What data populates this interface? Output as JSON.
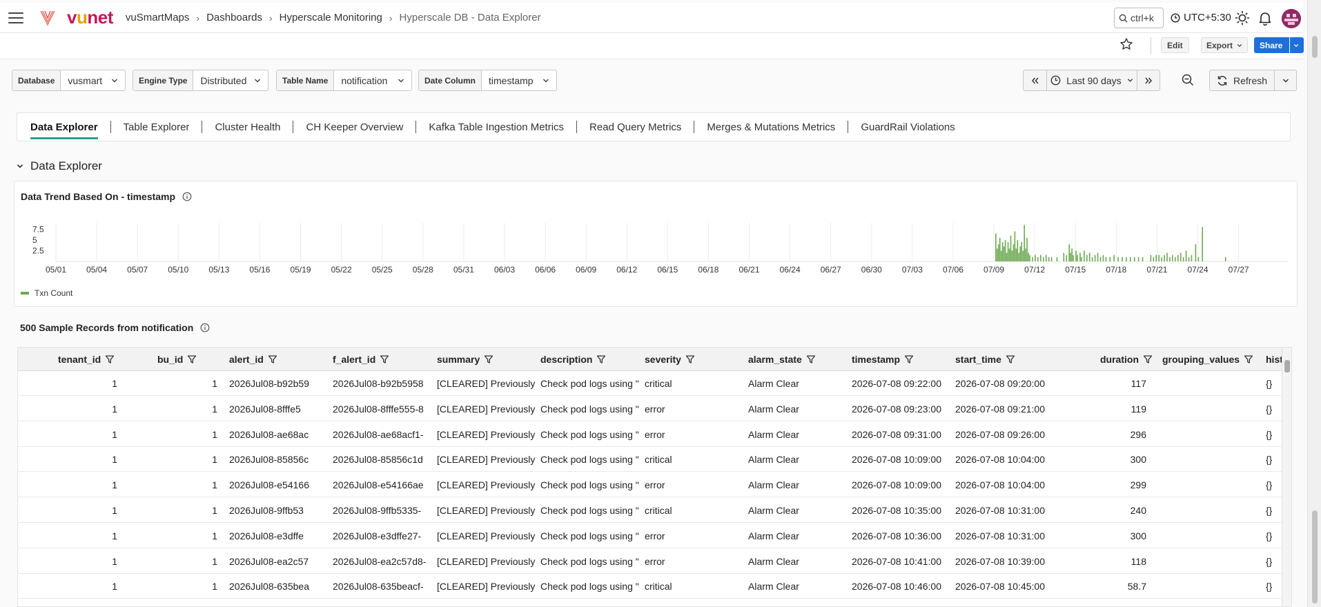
{
  "header": {
    "logo_text": "vunet",
    "breadcrumbs": [
      "vuSmartMaps",
      "Dashboards",
      "Hyperscale Monitoring",
      "Hyperscale DB - Data Explorer"
    ],
    "search_placeholder": "ctrl+k",
    "timezone": "UTC+5:30"
  },
  "actions": {
    "edit_label": "Edit",
    "export_label": "Export",
    "share_label": "Share"
  },
  "filters": [
    {
      "label": "Database",
      "value": "vusmart"
    },
    {
      "label": "Engine Type",
      "value": "Distributed"
    },
    {
      "label": "Table Name",
      "value": "notification"
    },
    {
      "label": "Date Column",
      "value": "timestamp"
    }
  ],
  "time_range": "Last 90 days",
  "refresh_label": "Refresh",
  "tabs": [
    {
      "label": "Data Explorer",
      "active": true
    },
    {
      "label": "Table Explorer",
      "active": false
    },
    {
      "label": "Cluster Health",
      "active": false
    },
    {
      "label": "CH Keeper Overview",
      "active": false
    },
    {
      "label": "Kafka Table Ingestion Metrics",
      "active": false
    },
    {
      "label": "Read Query Metrics",
      "active": false
    },
    {
      "label": "Merges & Mutations Metrics",
      "active": false
    },
    {
      "label": "GuardRail Violations",
      "active": false
    }
  ],
  "section_title": "Data Explorer",
  "chart_panel_title": "Data Trend Based On - timestamp",
  "chart_data": {
    "type": "bar",
    "series": [
      {
        "name": "Txn Count",
        "color": "#6aa84f"
      }
    ],
    "ylim": [
      0,
      9
    ],
    "y_ticks": [
      "2.5",
      "5",
      "7.5"
    ],
    "x_ticks": [
      "05/01",
      "05/04",
      "05/07",
      "05/10",
      "05/13",
      "05/16",
      "05/19",
      "05/22",
      "05/25",
      "05/28",
      "05/31",
      "06/03",
      "06/06",
      "06/09",
      "06/12",
      "06/15",
      "06/18",
      "06/21",
      "06/24",
      "06/27",
      "06/30",
      "07/03",
      "07/06",
      "07/09",
      "07/12",
      "07/15",
      "07/18",
      "07/21",
      "07/24",
      "07/27"
    ],
    "x_range_days": [
      0,
      89
    ],
    "bars": [
      [
        69.1,
        6.5
      ],
      [
        69.2,
        3
      ],
      [
        69.3,
        4
      ],
      [
        69.4,
        5.5
      ],
      [
        69.5,
        2.5
      ],
      [
        69.6,
        4.5
      ],
      [
        69.7,
        3.5
      ],
      [
        69.8,
        5
      ],
      [
        69.9,
        2
      ],
      [
        70.0,
        4.5
      ],
      [
        70.1,
        3
      ],
      [
        70.2,
        6
      ],
      [
        70.3,
        2.5
      ],
      [
        70.4,
        4
      ],
      [
        70.5,
        7
      ],
      [
        70.6,
        3
      ],
      [
        70.7,
        5
      ],
      [
        70.8,
        2
      ],
      [
        70.9,
        3.5
      ],
      [
        71.0,
        4.5
      ],
      [
        71.1,
        2.5
      ],
      [
        71.2,
        8.5
      ],
      [
        71.3,
        3
      ],
      [
        71.4,
        5.5
      ],
      [
        71.5,
        2
      ],
      [
        71.6,
        1.5
      ],
      [
        71.8,
        1
      ],
      [
        72.0,
        1.5
      ],
      [
        72.2,
        1
      ],
      [
        72.4,
        1.5
      ],
      [
        72.6,
        1
      ],
      [
        72.8,
        1.5
      ],
      [
        73.0,
        1
      ],
      [
        73.2,
        1
      ],
      [
        73.6,
        1
      ],
      [
        74.1,
        2
      ],
      [
        74.3,
        1.5
      ],
      [
        74.5,
        4
      ],
      [
        74.6,
        2
      ],
      [
        74.7,
        3
      ],
      [
        74.8,
        1.5
      ],
      [
        75.0,
        2.5
      ],
      [
        75.1,
        1.5
      ],
      [
        75.3,
        2
      ],
      [
        75.4,
        1
      ],
      [
        75.6,
        2.5
      ],
      [
        75.8,
        1.5
      ],
      [
        76.0,
        2
      ],
      [
        76.2,
        1
      ],
      [
        76.4,
        1.5
      ],
      [
        76.6,
        2
      ],
      [
        76.8,
        1
      ],
      [
        77.0,
        1.5
      ],
      [
        77.2,
        1
      ],
      [
        77.5,
        1
      ],
      [
        77.8,
        1.5
      ],
      [
        78.1,
        1
      ],
      [
        78.4,
        1
      ],
      [
        78.7,
        1
      ],
      [
        79.0,
        1
      ],
      [
        79.3,
        1
      ],
      [
        79.6,
        1
      ],
      [
        79.9,
        1
      ],
      [
        80.5,
        1.5
      ],
      [
        80.7,
        1
      ],
      [
        80.9,
        1.5
      ],
      [
        81.1,
        1.5
      ],
      [
        81.3,
        1
      ],
      [
        81.5,
        1.5
      ],
      [
        81.7,
        2
      ],
      [
        81.9,
        1
      ],
      [
        82.1,
        1.5
      ],
      [
        82.3,
        1
      ],
      [
        82.5,
        1.5
      ],
      [
        82.7,
        2
      ],
      [
        82.9,
        1
      ],
      [
        83.1,
        2.5
      ],
      [
        83.3,
        1
      ],
      [
        83.5,
        1.5
      ],
      [
        83.8,
        4
      ],
      [
        84.0,
        1
      ],
      [
        84.3,
        8
      ],
      [
        86.0,
        1
      ]
    ]
  },
  "table_title": "500 Sample Records from notification",
  "table": {
    "columns": [
      "tenant_id",
      "bu_id",
      "alert_id",
      "f_alert_id",
      "summary",
      "description",
      "severity",
      "alarm_state",
      "timestamp",
      "start_time",
      "duration",
      "grouping_values",
      "hist"
    ],
    "rows": [
      [
        "1",
        "1",
        "2026Jul08-b92b59",
        "2026Jul08-b92b5958",
        "[CLEARED] Previously",
        "Check pod logs using \"",
        "critical",
        "Alarm Clear",
        "2026-07-08 09:22:00",
        "2026-07-08 09:20:00",
        "117",
        "",
        "{}"
      ],
      [
        "1",
        "1",
        "2026Jul08-8fffe5",
        "2026Jul08-8fffe555-8",
        "[CLEARED] Previously",
        "Check pod logs using \"",
        "error",
        "Alarm Clear",
        "2026-07-08 09:23:00",
        "2026-07-08 09:21:00",
        "119",
        "",
        "{}"
      ],
      [
        "1",
        "1",
        "2026Jul08-ae68ac",
        "2026Jul08-ae68acf1-",
        "[CLEARED] Previously",
        "Check pod logs using \"",
        "error",
        "Alarm Clear",
        "2026-07-08 09:31:00",
        "2026-07-08 09:26:00",
        "296",
        "",
        "{}"
      ],
      [
        "1",
        "1",
        "2026Jul08-85856c",
        "2026Jul08-85856c1d",
        "[CLEARED] Previously",
        "Check pod logs using \"",
        "critical",
        "Alarm Clear",
        "2026-07-08 10:09:00",
        "2026-07-08 10:04:00",
        "300",
        "",
        "{}"
      ],
      [
        "1",
        "1",
        "2026Jul08-e54166",
        "2026Jul08-e54166ae",
        "[CLEARED] Previously",
        "Check pod logs using \"",
        "error",
        "Alarm Clear",
        "2026-07-08 10:09:00",
        "2026-07-08 10:04:00",
        "299",
        "",
        "{}"
      ],
      [
        "1",
        "1",
        "2026Jul08-9ffb53",
        "2026Jul08-9ffb5335-",
        "[CLEARED] Previously",
        "Check pod logs using \"",
        "critical",
        "Alarm Clear",
        "2026-07-08 10:35:00",
        "2026-07-08 10:31:00",
        "240",
        "",
        "{}"
      ],
      [
        "1",
        "1",
        "2026Jul08-e3dffe",
        "2026Jul08-e3dffe27-",
        "[CLEARED] Previously",
        "Check pod logs using \"",
        "error",
        "Alarm Clear",
        "2026-07-08 10:36:00",
        "2026-07-08 10:31:00",
        "300",
        "",
        "{}"
      ],
      [
        "1",
        "1",
        "2026Jul08-ea2c57",
        "2026Jul08-ea2c57d8-",
        "[CLEARED] Previously",
        "Check pod logs using \"",
        "error",
        "Alarm Clear",
        "2026-07-08 10:41:00",
        "2026-07-08 10:39:00",
        "118",
        "",
        "{}"
      ],
      [
        "1",
        "1",
        "2026Jul08-635bea",
        "2026Jul08-635beacf-",
        "[CLEARED] Previously",
        "Check pod logs using \"",
        "critical",
        "Alarm Clear",
        "2026-07-08 10:46:00",
        "2026-07-08 10:45:00",
        "58.7",
        "",
        "{}"
      ]
    ]
  }
}
